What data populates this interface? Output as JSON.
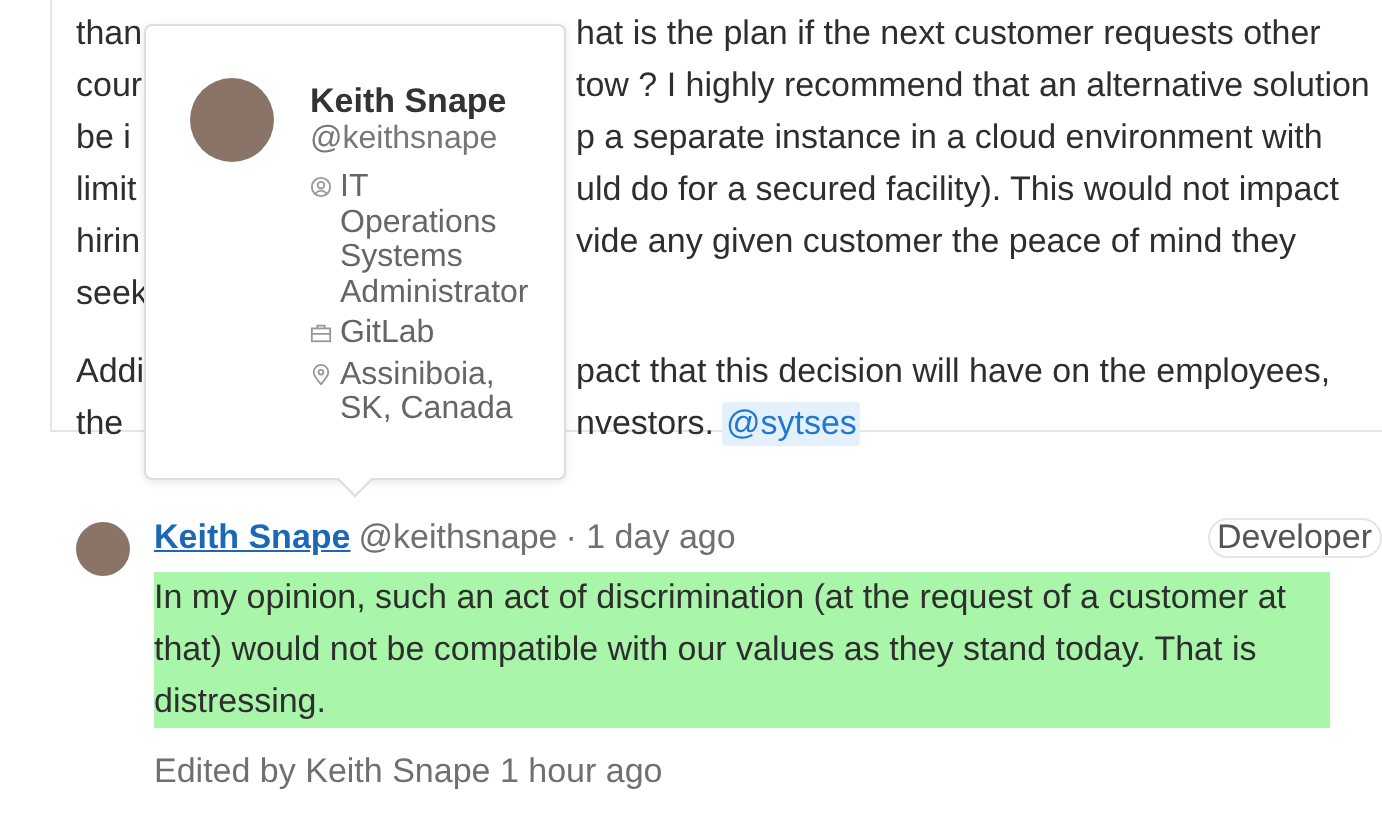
{
  "previous_comment": {
    "paragraphs": [
      [
        {
          "left": "than",
          "right": "hat is the plan if the next customer requests other"
        },
        {
          "left": "cour",
          "right": "tow ? I highly recommend that an alternative solution"
        },
        {
          "left": "be i",
          "right": "p a separate instance in a cloud environment with"
        },
        {
          "left": "limit",
          "right": "uld do for a secured facility). This would not impact"
        },
        {
          "left": "hirin",
          "right": "vide any given customer the peace of mind they"
        },
        {
          "left": "seek"
        }
      ],
      [
        {
          "left": "Addi",
          "right": "pact that this decision will have on the employees,"
        },
        {
          "left": "the",
          "right": "nvestors.",
          "mention": "@sytses"
        }
      ]
    ]
  },
  "user_popover": {
    "name": "Keith Snape",
    "handle": "@keithsnape",
    "job_title": "IT Operations Systems Administrator",
    "organization": "GitLab",
    "location": "Assiniboia, SK, Canada"
  },
  "comment": {
    "author": "Keith Snape",
    "handle": "@keithsnape",
    "time": "· 1 day ago",
    "role_badge": "Developer",
    "highlighted": true,
    "body": "In my opinion, such an act of discrimination (at the request of a customer at that) would not be compatible with our values as they stand today. That is distressing.",
    "edited": "Edited by Keith Snape 1 hour ago"
  }
}
